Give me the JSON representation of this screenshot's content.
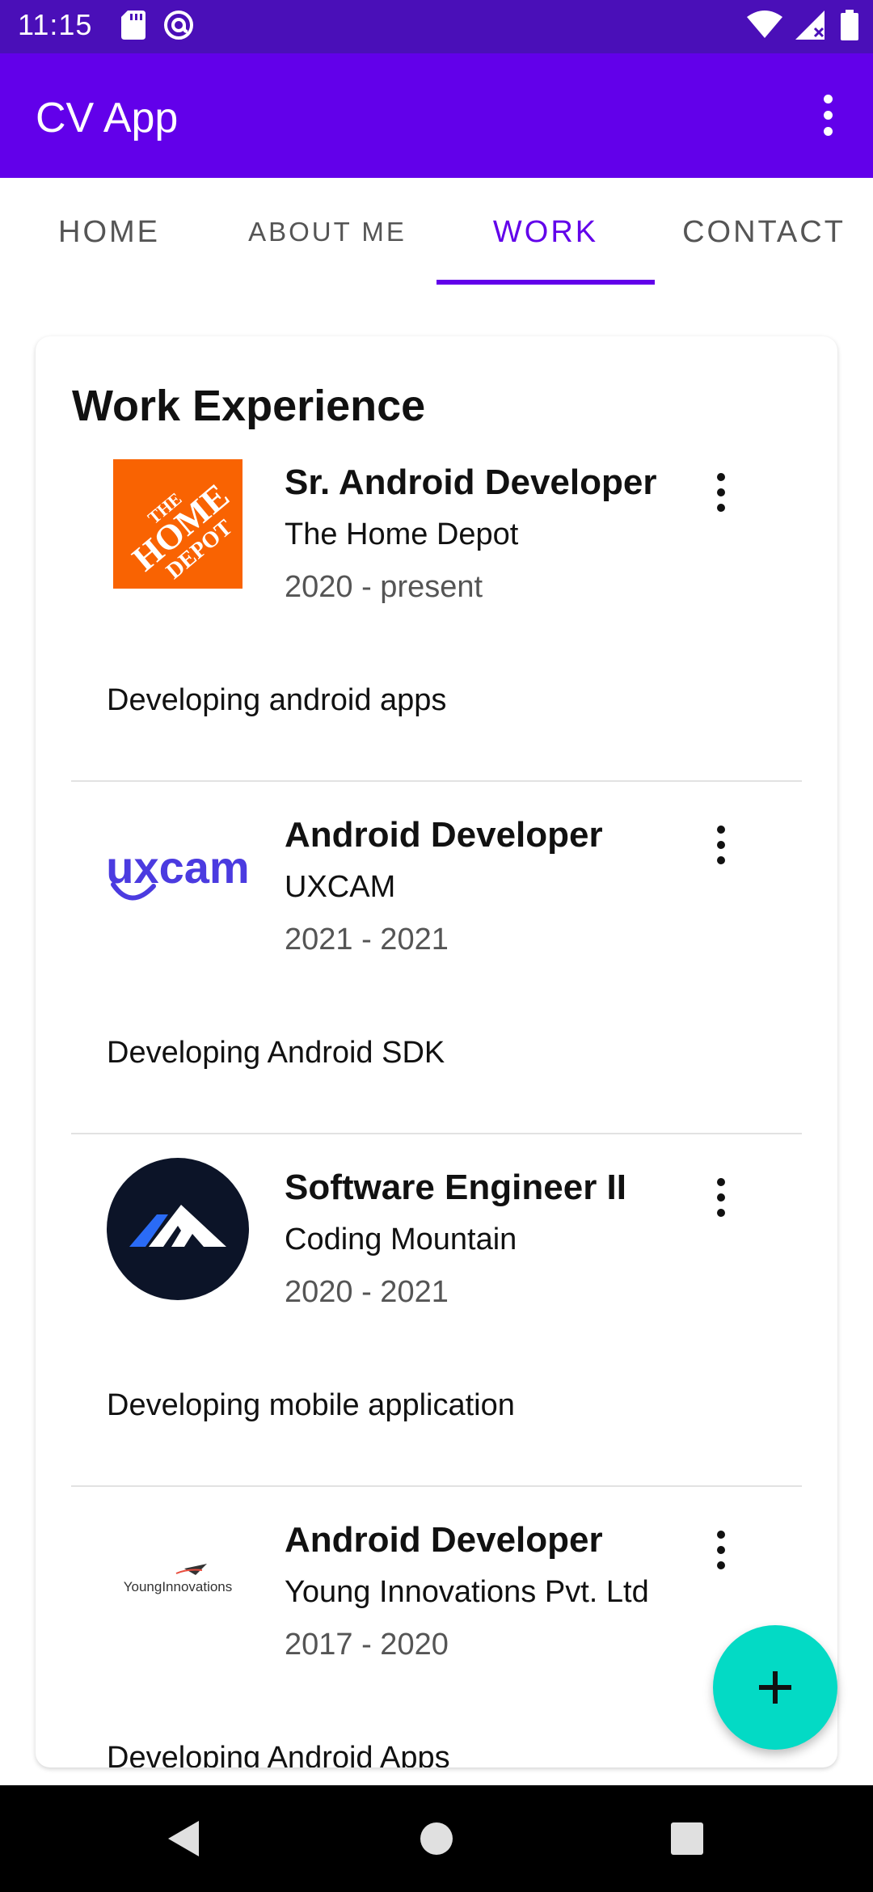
{
  "status_bar": {
    "time": "11:15",
    "icons": [
      "sd-card-icon",
      "at-sign-icon",
      "wifi-icon",
      "signal-icon",
      "battery-icon"
    ]
  },
  "app_bar": {
    "title": "CV App",
    "menu_icon": "more-vert-icon",
    "color": "#6200ea"
  },
  "tabs": [
    {
      "label": "HOME",
      "selected": false
    },
    {
      "label": "ABOUT ME",
      "selected": false
    },
    {
      "label": "WORK",
      "selected": true
    },
    {
      "label": "CONTACT",
      "selected": false
    }
  ],
  "work": {
    "title": "Work Experience",
    "items": [
      {
        "title": "Sr. Android Developer",
        "company": "The Home Depot",
        "years": "2020 - present",
        "description": "Developing android apps",
        "logo": "home-depot-logo"
      },
      {
        "title": "Android Developer",
        "company": "UXCAM",
        "years": "2021 - 2021",
        "description": "Developing Android SDK",
        "logo": "uxcam-logo",
        "logo_text": "uxcam"
      },
      {
        "title": "Software Engineer II",
        "company": "Coding Mountain",
        "years": "2020 - 2021",
        "description": "Developing mobile application",
        "logo": "coding-mountain-logo"
      },
      {
        "title": "Android Developer",
        "company": "Young Innovations Pvt. Ltd",
        "years": "2017 - 2020",
        "description": "Developing Android Apps",
        "logo": "young-innovations-logo"
      }
    ]
  },
  "fab": {
    "icon": "add-icon",
    "color": "#03dac5"
  },
  "nav_bar": {
    "icons": [
      "back-icon",
      "home-icon",
      "recents-icon"
    ]
  }
}
